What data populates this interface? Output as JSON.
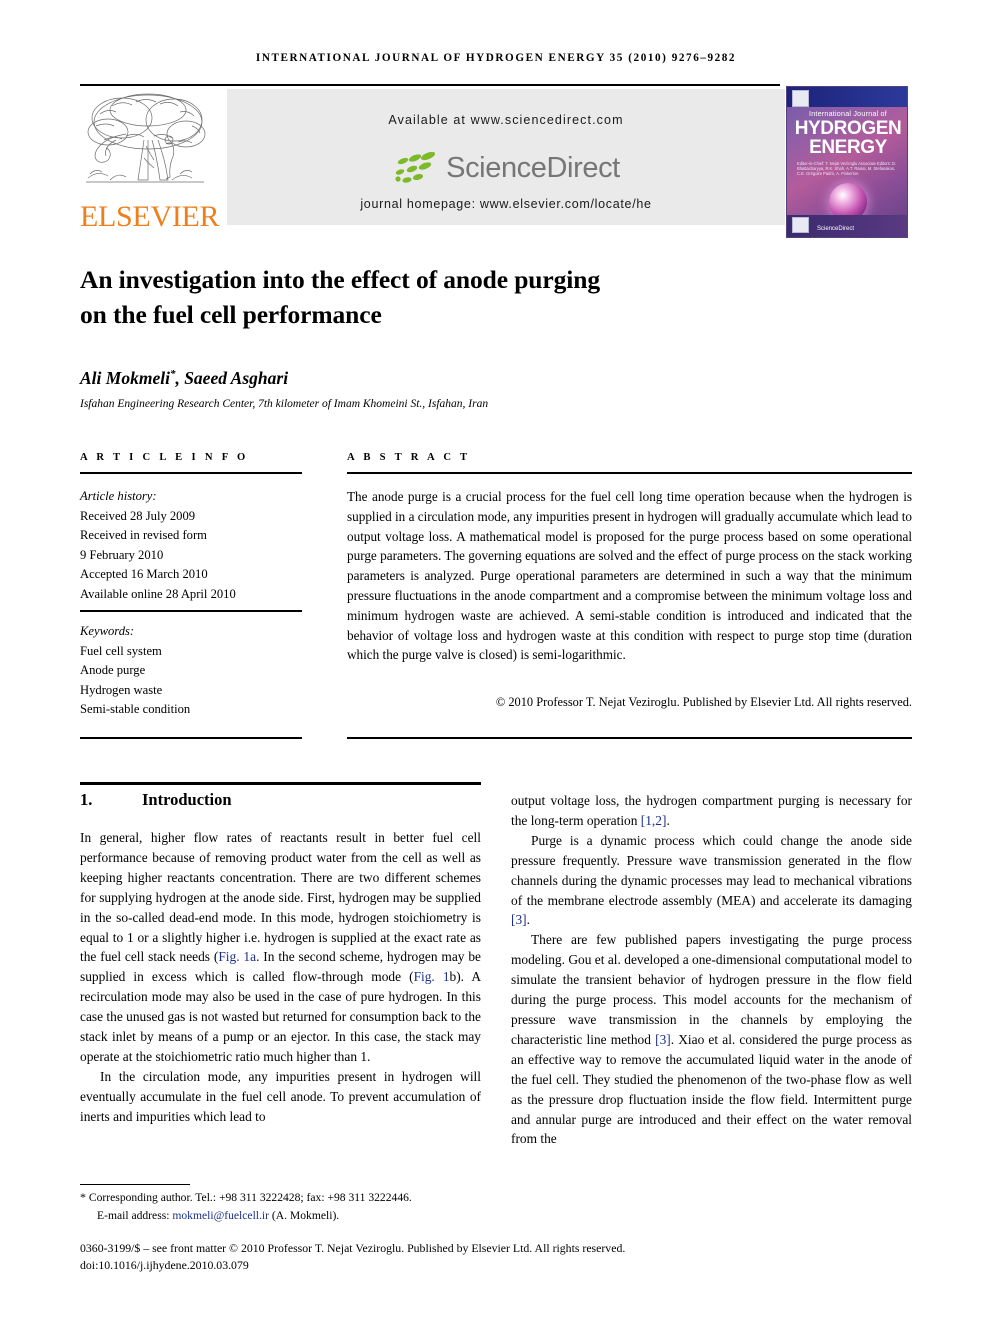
{
  "running_head": "INTERNATIONAL JOURNAL OF HYDROGEN ENERGY 35 (2010) 9276–9282",
  "masthead": {
    "publisher_name": "ELSEVIER",
    "available_at": "Available at www.sciencedirect.com",
    "sciencedirect_wordmark": "ScienceDirect",
    "journal_homepage": "journal homepage: www.elsevier.com/locate/he",
    "cover": {
      "line_intl": "International Journal of",
      "line_1": "HYDROGEN",
      "line_2": "ENERGY",
      "editors": "Editor-in-Chief:  T. Nejat Veziroglu   Associate Editors: D. Bhattacharyya, R.K. Shah, A.T. Raissi, M. Stefanakos, C.E. Grégoire Padró, A. Pinkerton",
      "sciencedirect": "ScienceDirect"
    }
  },
  "article": {
    "title_line_1": "An investigation into the effect of anode purging",
    "title_line_2": "on the fuel cell performance",
    "authors": "Ali Mokmeli",
    "authors_marker": "*",
    "authors_rest": ", Saeed Asghari",
    "affiliation": "Isfahan Engineering Research Center, 7th kilometer of Imam Khomeini St., Isfahan, Iran"
  },
  "info": {
    "heading": "A R T I C L E   I N F O",
    "history_label": "Article history:",
    "history": [
      "Received 28 July 2009",
      "Received in revised form",
      "9 February 2010",
      "Accepted 16 March 2010",
      "Available online 28 April 2010"
    ],
    "keywords_label": "Keywords:",
    "keywords": [
      "Fuel cell system",
      "Anode purge",
      "Hydrogen waste",
      "Semi-stable condition"
    ]
  },
  "abstract": {
    "heading": "A B S T R A C T",
    "text": "The anode purge is a crucial process for the fuel cell long time operation because when the hydrogen is supplied in a circulation mode, any impurities present in hydrogen will gradually accumulate which lead to output voltage loss. A mathematical model is proposed for the purge process based on some operational purge parameters. The governing equations are solved and the effect of purge process on the stack working parameters is analyzed. Purge operational parameters are determined in such a way that the minimum pressure fluctuations in the anode compartment and a compromise between the minimum voltage loss and minimum hydrogen waste are achieved. A semi-stable condition is introduced and indicated that the behavior of voltage loss and hydrogen waste at this condition with respect to purge stop time (duration which the purge valve is closed) is semi-logarithmic.",
    "copyright": "© 2010 Professor T. Nejat Veziroglu. Published by Elsevier Ltd. All rights reserved."
  },
  "body": {
    "section_number": "1.",
    "section_title": "Introduction",
    "left_p1_a": "In general, higher flow rates of reactants result in better fuel cell performance because of removing product water from the cell as well as keeping higher reactants concentration. There are two different schemes for supplying hydrogen at the anode side. First, hydrogen may be supplied in the so-called dead-end mode. In this mode, hydrogen stoichiometry is equal to 1 or a slightly higher i.e. hydrogen is supplied at the exact rate as the fuel cell stack needs ",
    "left_p1_ref1": "Fig. 1a",
    "left_p1_b": ". In the second scheme, hydrogen may be supplied in excess which is called flow-through mode (",
    "left_p1_ref2": "Fig. 1",
    "left_p1_ref2b": "b",
    "left_p1_c": "). A recirculation mode may also be used in the case of pure hydrogen. In this case the unused gas is not wasted but returned for consumption back to the stack inlet by means of a pump or an ejector. In this case, the stack may operate at the stoichiometric ratio much higher than 1.",
    "left_p2": "In the circulation mode, any impurities present in hydrogen will eventually accumulate in the fuel cell anode. To prevent accumulation of inerts and impurities which lead to",
    "right_p1_a": "output voltage loss, the hydrogen compartment purging is necessary for the long-term operation ",
    "right_p1_ref": "[1,2]",
    "right_p1_b": ".",
    "right_p2_a": "Purge is a dynamic process which could change the anode side pressure frequently. Pressure wave transmission generated in the flow channels during the dynamic processes may lead to mechanical vibrations of the membrane electrode assembly (MEA) and accelerate its damaging ",
    "right_p2_ref": "[3]",
    "right_p2_b": ".",
    "right_p3_a": "There are few published papers investigating the purge process modeling. Gou et al. developed a one-dimensional computational model to simulate the transient behavior of hydrogen pressure in the flow field during the purge process. This model accounts for the mechanism of pressure wave transmission in the channels by employing the characteristic line method ",
    "right_p3_ref": "[3]",
    "right_p3_b": ". Xiao et al. considered the purge process as an effective way to remove the accumulated liquid water in the anode of the fuel cell. They studied the phenomenon of the two-phase flow as well as the pressure drop fluctuation inside the flow field. Intermittent purge and annular purge are introduced and their effect on the water removal from the"
  },
  "footer": {
    "corresponding_marker": "*",
    "corresponding": "Corresponding author. Tel.: +98 311 3222428; fax: +98 311 3222446.",
    "email_label": "E-mail address:",
    "email": "mokmeli@fuelcell.ir",
    "email_owner": "(A. Mokmeli).",
    "front_matter": "0360-3199/$ – see front matter © 2010 Professor T. Nejat Veziroglu. Published by Elsevier Ltd. All rights reserved.",
    "doi": "doi:10.1016/j.ijhydene.2010.03.079"
  },
  "colors": {
    "link_blue": "#1c2f8c",
    "elsevier_orange": "#EF7F1A",
    "sciencedirect_green": "#7DB928",
    "sciencedirect_gray": "#767676",
    "panel_gray": "#eaeaea"
  }
}
